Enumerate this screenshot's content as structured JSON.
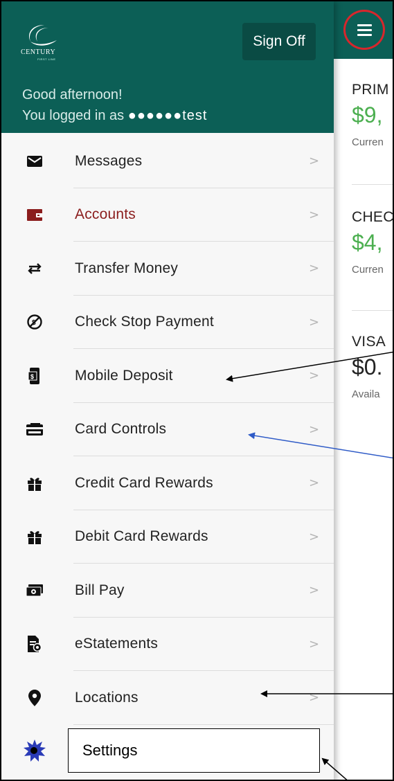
{
  "header": {
    "logo_text": "CENTURY",
    "logo_sub": "FIRST LINE",
    "signoff_label": "Sign Off",
    "greeting": "Good afternoon!",
    "logged_in_prefix": "You logged in as",
    "username_masked": "●●●●●●test"
  },
  "menu": {
    "items": [
      {
        "label": "Messages",
        "icon": "envelope-icon"
      },
      {
        "label": "Accounts",
        "icon": "wallet-icon"
      },
      {
        "label": "Transfer Money",
        "icon": "transfer-arrows-icon"
      },
      {
        "label": "Check Stop Payment",
        "icon": "stop-payment-icon"
      },
      {
        "label": "Mobile Deposit",
        "icon": "mobile-deposit-icon"
      },
      {
        "label": "Card Controls",
        "icon": "card-icon"
      },
      {
        "label": "Credit Card Rewards",
        "icon": "gift-icon"
      },
      {
        "label": "Debit Card Rewards",
        "icon": "gift-icon"
      },
      {
        "label": "Bill Pay",
        "icon": "cash-icon"
      },
      {
        "label": "eStatements",
        "icon": "statement-icon"
      },
      {
        "label": "Locations",
        "icon": "location-pin-icon"
      }
    ],
    "settings_label": "Settings",
    "chevron": ">"
  },
  "accounts_panel": {
    "accounts": [
      {
        "name": "PRIM",
        "balance": "$9,",
        "sub": "Curren"
      },
      {
        "name": "CHEC",
        "balance": "$4,",
        "sub": "Curren"
      },
      {
        "name": "VISA",
        "balance": "$0.",
        "sub": "Availa"
      }
    ]
  },
  "colors": {
    "header": "#0c5f56",
    "active": "#8b1d1d",
    "balance_green": "#4caf50",
    "highlight_ring": "#d8262c"
  }
}
